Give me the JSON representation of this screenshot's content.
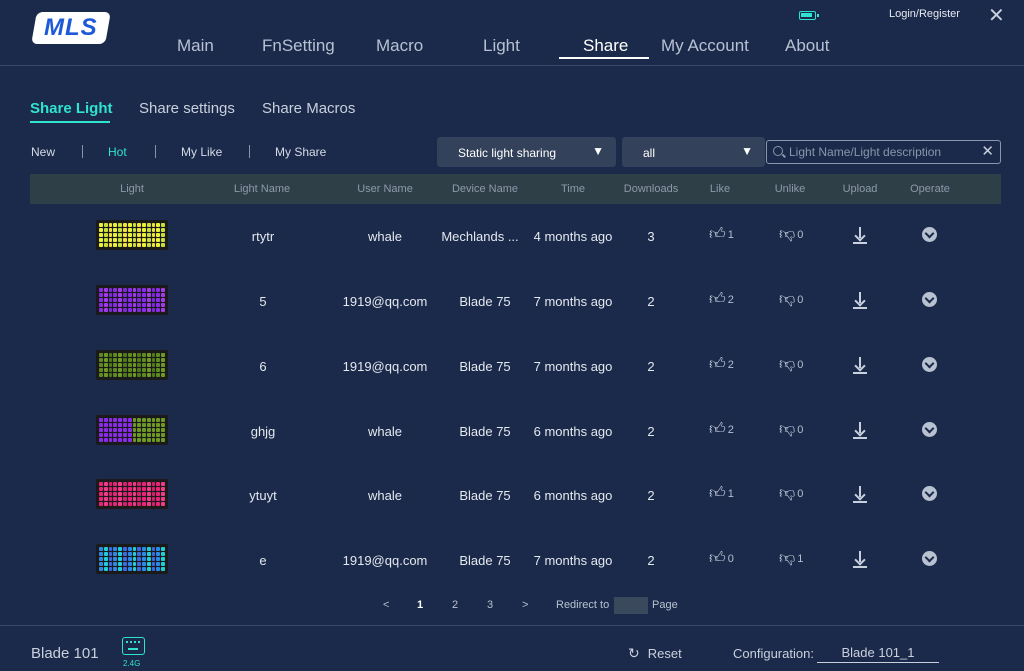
{
  "app": {
    "logo_text": "MLS",
    "login_label": "Login/Register"
  },
  "icons": {
    "battery": "battery-icon",
    "close": "close-icon",
    "search": "search-icon",
    "like": "thumbs-up-icon",
    "unlike": "thumbs-down-icon",
    "upload": "download-icon",
    "operate": "chevron-down-circle-icon",
    "refresh": "refresh-icon",
    "keyboard": "keyboard-icon"
  },
  "colors": {
    "background": "#1b2a4a",
    "accent": "#2ee3d0",
    "header_row": "#2f3f48",
    "dropdown": "#33425a"
  },
  "main_nav": {
    "items": [
      {
        "label": "Main",
        "active": false
      },
      {
        "label": "FnSetting",
        "active": false
      },
      {
        "label": "Macro",
        "active": false
      },
      {
        "label": "Light",
        "active": false
      },
      {
        "label": "Share",
        "active": true
      },
      {
        "label": "My Account",
        "active": false
      },
      {
        "label": "About",
        "active": false
      }
    ]
  },
  "sub_tabs": {
    "items": [
      {
        "label": "Share Light",
        "active": true
      },
      {
        "label": "Share settings",
        "active": false
      },
      {
        "label": "Share Macros",
        "active": false
      }
    ]
  },
  "filters": {
    "items": [
      {
        "label": "New",
        "active": false
      },
      {
        "label": "Hot",
        "active": true
      },
      {
        "label": "My Like",
        "active": false
      },
      {
        "label": "My Share",
        "active": false
      }
    ],
    "type_dropdown": {
      "selected": "Static light sharing"
    },
    "scope_dropdown": {
      "selected": "all"
    },
    "search": {
      "value": "",
      "placeholder": "Light Name/Light description"
    }
  },
  "table": {
    "headers": [
      "Light",
      "Light Name",
      "User Name",
      "Device Name",
      "Time",
      "Downloads",
      "Like",
      "Unlike",
      "Upload",
      "Operate"
    ],
    "rows": [
      {
        "light_theme": "yellow",
        "light_name": "rtytr",
        "user_name": "whale",
        "device_name": "Mechlands ...",
        "time": "4 months ago",
        "downloads": "3",
        "likes": "1",
        "unlikes": "0"
      },
      {
        "light_theme": "purple",
        "light_name": "5",
        "user_name": "1919@qq.com",
        "device_name": "Blade 75",
        "time": "7 months ago",
        "downloads": "2",
        "likes": "2",
        "unlikes": "0"
      },
      {
        "light_theme": "green",
        "light_name": "6",
        "user_name": "1919@qq.com",
        "device_name": "Blade 75",
        "time": "7 months ago",
        "downloads": "2",
        "likes": "2",
        "unlikes": "0"
      },
      {
        "light_theme": "purple-green",
        "light_name": "ghjg",
        "user_name": "whale",
        "device_name": "Blade 75",
        "time": "6 months ago",
        "downloads": "2",
        "likes": "2",
        "unlikes": "0"
      },
      {
        "light_theme": "pink",
        "light_name": "ytuyt",
        "user_name": "whale",
        "device_name": "Blade 75",
        "time": "6 months ago",
        "downloads": "2",
        "likes": "1",
        "unlikes": "0"
      },
      {
        "light_theme": "blue",
        "light_name": "e",
        "user_name": "1919@qq.com",
        "device_name": "Blade 75",
        "time": "7 months ago",
        "downloads": "2",
        "likes": "0",
        "unlikes": "1"
      }
    ]
  },
  "pagination": {
    "prev": "<",
    "next": ">",
    "pages": [
      {
        "label": "1",
        "active": true
      },
      {
        "label": "2",
        "active": false
      },
      {
        "label": "3",
        "active": false
      }
    ],
    "redirect_label": "Redirect to",
    "redirect_value": "",
    "page_label": "Page"
  },
  "footer": {
    "device_name": "Blade 101",
    "connection": "2.4G",
    "reset_label": "Reset",
    "config_label": "Configuration:",
    "config_value": "Blade 101_1"
  }
}
